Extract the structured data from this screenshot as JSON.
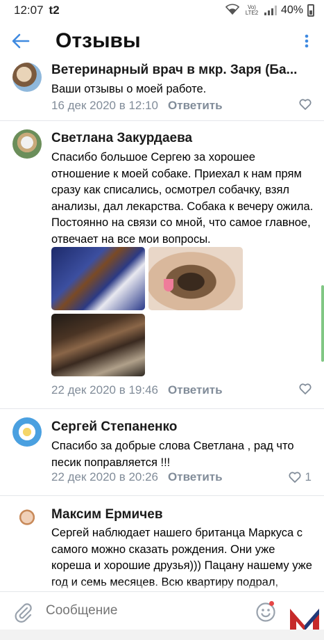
{
  "status": {
    "time": "12:07",
    "carrier": "t2",
    "volte": "Vo) LTE2",
    "battery": "40%"
  },
  "header": {
    "title": "Отзывы",
    "back_icon": "arrow-left-icon",
    "more_icon": "more-vertical-icon"
  },
  "comments": [
    {
      "author": "Ветеринарный врач в мкр. Заря (Ба...",
      "text": "Ваши отзывы о моей работе.",
      "date": "16 дек 2020 в 12:10",
      "reply": "Ответить",
      "likes": ""
    },
    {
      "author": "Светлана Закурдаева",
      "text": "Спасибо большое Сергею за хорошее отношение к моей собаке. Приехал к нам прям сразу как списались, осмотрел собачку, взял анализы, дал лекарства. Собака к вечеру ожила. Постоянно на связи со мной, что самое главное, отвечает на все мои вопросы.",
      "date": "22 дек 2020 в 19:46",
      "reply": "Ответить",
      "likes": ""
    },
    {
      "author": "Сергей Степаненко",
      "text": "Спасибо за добрые слова Светлана , рад что песик поправляется !!!",
      "date": "22 дек 2020 в 20:26",
      "reply": "Ответить",
      "likes": "1"
    },
    {
      "author": "Максим Ермичев",
      "text": "Сергей наблюдает нашего британца Маркуса с самого можно сказать рождения. Они уже кореша и хорошие друзья))) Пацану нашему уже год и семь месяцев. Всю квартиру подрал,",
      "date": "",
      "reply": "",
      "likes": ""
    }
  ],
  "composer": {
    "placeholder": "Сообщение"
  },
  "colors": {
    "accent": "#3f8ae0",
    "secondary_text": "#818c99",
    "divider": "#e4e6ea"
  }
}
